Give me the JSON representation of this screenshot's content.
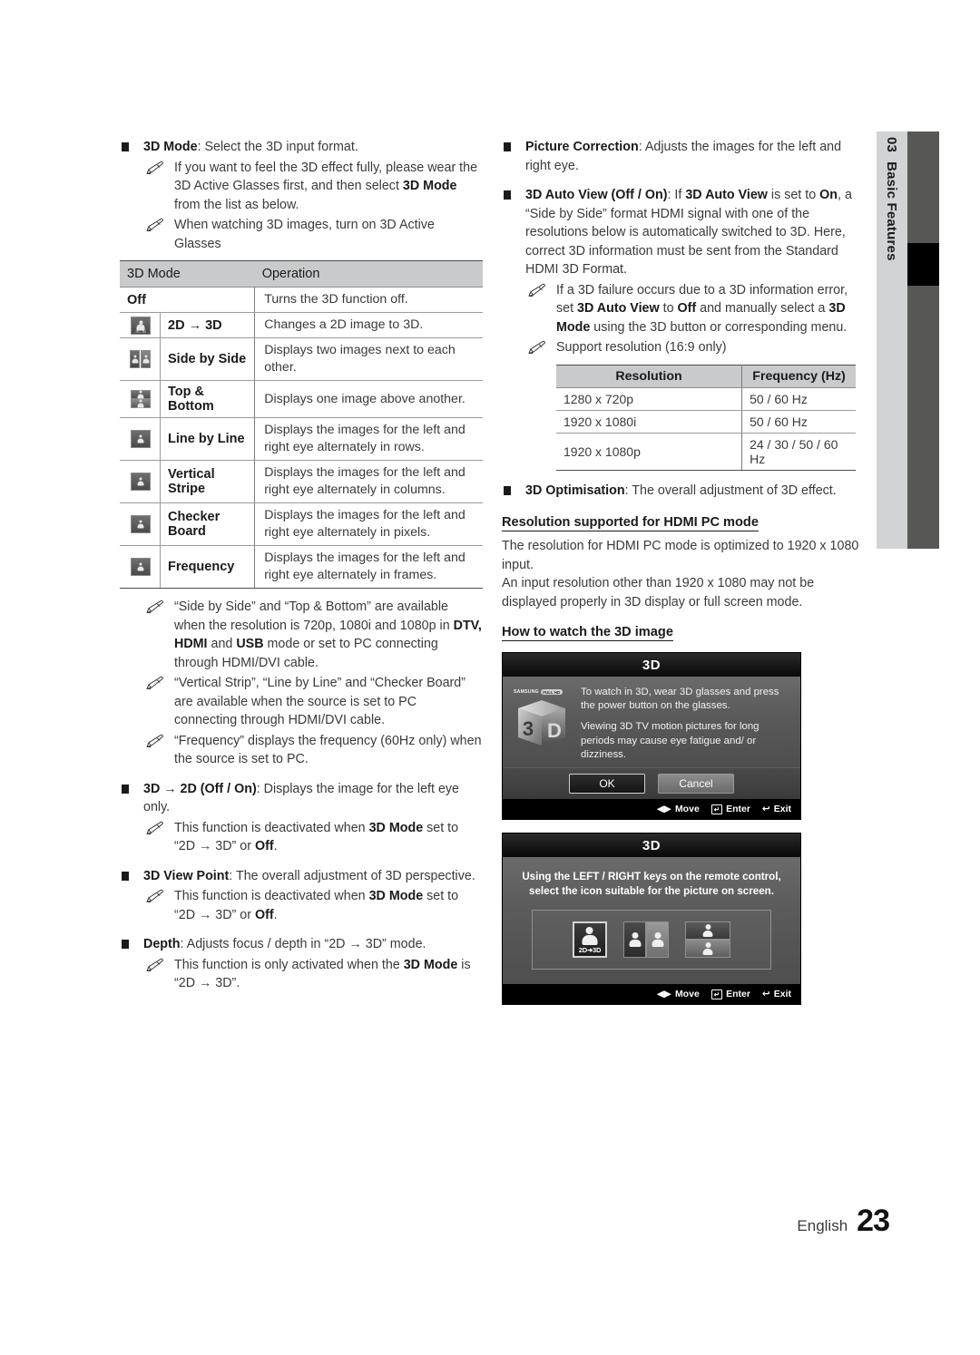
{
  "sidetab": {
    "chapter_number": "03",
    "chapter_title": "Basic Features"
  },
  "footer": {
    "language": "English",
    "page_number": "23"
  },
  "left_column": {
    "item_3d_mode": {
      "term": "3D Mode",
      "rest": ": Select the 3D input format.",
      "notes": [
        "If you want to feel the 3D effect fully, please wear the 3D Active Glasses first, and then select 3D Mode from the list as below.",
        "When watching 3D images, turn on 3D Active Glasses"
      ],
      "note1_a": "If you want to feel the 3D effect fully, please wear the 3D Active Glasses first, and then select ",
      "note1_b": "3D Mode",
      "note1_c": " from the list as below.",
      "note2": "When watching 3D images, turn on 3D Active Glasses"
    },
    "mode_table": {
      "headers": [
        "3D Mode",
        "Operation"
      ],
      "rows": [
        {
          "icon": "none",
          "name": "Off",
          "desc": "Turns the 3D function off."
        },
        {
          "icon": "2d-to-3d-icon",
          "name": "2D → 3D",
          "desc": "Changes a 2D image to 3D."
        },
        {
          "icon": "side-by-side-icon",
          "name": "Side by Side",
          "desc": "Displays two images next to each other."
        },
        {
          "icon": "top-bottom-icon",
          "name": "Top & Bottom",
          "desc": "Displays one image above another."
        },
        {
          "icon": "line-by-line-icon",
          "name": "Line by Line",
          "desc": "Displays the images for the left and right eye alternately in rows."
        },
        {
          "icon": "vertical-stripe-icon",
          "name": "Vertical Stripe",
          "desc": "Displays the images for the left and right eye alternately in columns."
        },
        {
          "icon": "checker-board-icon",
          "name": "Checker Board",
          "desc": "Displays the images for the left and right eye alternately in pixels."
        },
        {
          "icon": "frequency-icon",
          "name": "Frequency",
          "desc": "Displays the images for the left and right eye alternately in frames."
        }
      ]
    },
    "notes_after_table": [
      {
        "parts": [
          {
            "t": "“Side by Side” and “Top & Bottom” are available when the resolution is 720p, 1080i and 1080p in ",
            "b": false
          },
          {
            "t": "DTV, HDMI",
            "b": true
          },
          {
            "t": " and ",
            "b": false
          },
          {
            "t": "USB",
            "b": true
          },
          {
            "t": " mode or set to PC connecting through HDMI/DVI cable.",
            "b": false
          }
        ]
      },
      {
        "parts": [
          {
            "t": "“Vertical Strip”, “Line by Line” and “Checker Board” are available when the source is set to PC connecting through HDMI/DVI cable.",
            "b": false
          }
        ]
      },
      {
        "parts": [
          {
            "t": "“Frequency” displays the frequency (60Hz only) when the source is set to PC.",
            "b": false
          }
        ]
      }
    ],
    "item_3d_to_2d": {
      "term": "3D → 2D (Off / On)",
      "rest": ": Displays the image for the left eye only.",
      "note_parts": [
        {
          "t": "This function is deactivated when ",
          "b": false
        },
        {
          "t": "3D Mode",
          "b": true
        },
        {
          "t": " set to “2D → 3D” or ",
          "b": false
        },
        {
          "t": "Off",
          "b": true
        },
        {
          "t": ".",
          "b": false
        }
      ]
    },
    "item_view_point": {
      "term": "3D View Point",
      "rest": ": The overall adjustment of 3D perspective.",
      "note_parts": [
        {
          "t": "This function is deactivated when ",
          "b": false
        },
        {
          "t": "3D Mode",
          "b": true
        },
        {
          "t": " set to “2D → 3D” or ",
          "b": false
        },
        {
          "t": "Off",
          "b": true
        },
        {
          "t": ".",
          "b": false
        }
      ]
    },
    "item_depth": {
      "term": "Depth",
      "rest": ": Adjusts focus / depth in “2D → 3D” mode.",
      "note_parts": [
        {
          "t": "This function is only activated when the ",
          "b": false
        },
        {
          "t": "3D Mode",
          "b": true
        },
        {
          "t": " is “2D → 3D”.",
          "b": false
        }
      ]
    }
  },
  "right_column": {
    "item_picture_correction": {
      "term": "Picture Correction",
      "rest": ": Adjusts the images for the left and right eye."
    },
    "item_auto_view": {
      "parts": [
        {
          "t": "3D Auto View (Off / On)",
          "b": true
        },
        {
          "t": ": If ",
          "b": false
        },
        {
          "t": "3D Auto View",
          "b": true
        },
        {
          "t": " is set to ",
          "b": false
        },
        {
          "t": "On",
          "b": true
        },
        {
          "t": ", a “Side by Side” format HDMI signal with one of the resolutions below is automatically switched to 3D. Here, correct 3D information must be sent from the Standard HDMI 3D Format.",
          "b": false
        }
      ],
      "note1_parts": [
        {
          "t": "If a 3D failure occurs due to a 3D information error, set ",
          "b": false
        },
        {
          "t": "3D Auto View",
          "b": true
        },
        {
          "t": " to ",
          "b": false
        },
        {
          "t": "Off",
          "b": true
        },
        {
          "t": " and manually select a ",
          "b": false
        },
        {
          "t": "3D Mode",
          "b": true
        },
        {
          "t": " using the 3D button or corresponding menu.",
          "b": false
        }
      ],
      "note2": "Support resolution (16:9 only)"
    },
    "resolution_table": {
      "headers": [
        "Resolution",
        "Frequency (Hz)"
      ],
      "rows": [
        [
          "1280 x 720p",
          "50 / 60 Hz"
        ],
        [
          "1920 x 1080i",
          "50 / 60 Hz"
        ],
        [
          "1920 x 1080p",
          "24 / 30 / 50 / 60 Hz"
        ]
      ]
    },
    "item_optimisation": {
      "term": "3D Optimisation",
      "rest": ": The overall adjustment of 3D effect."
    },
    "heading_hdmi_pc": "Resolution supported for HDMI PC mode",
    "para_hdmi_pc_1": "The resolution for HDMI PC mode is optimized to 1920 x 1080 input.",
    "para_hdmi_pc_2": "An input resolution other than 1920 x 1080 may not be displayed properly in 3D display or full screen mode.",
    "heading_how_to_watch": "How to watch the 3D image"
  },
  "tv_screen_1": {
    "title": "3D",
    "logo_brand": "SAMSUNG",
    "logo_badge": "FULL HD",
    "logo_text": "3D",
    "body_line_1": "To watch in 3D, wear 3D glasses and press the power button on the glasses.",
    "body_line_2": "Viewing 3D TV motion pictures for long periods may cause eye  fatigue and/ or dizziness.",
    "buttons": {
      "ok": "OK",
      "cancel": "Cancel"
    },
    "footer_hints": [
      {
        "icon": "left-right-arrow-icon",
        "label": "Move"
      },
      {
        "icon": "enter-key-icon",
        "label": "Enter"
      },
      {
        "icon": "return-arrow-icon",
        "label": "Exit"
      }
    ]
  },
  "tv_screen_2": {
    "title": "3D",
    "body_line_1": "Using the LEFT / RIGHT keys on the remote control,",
    "body_line_2": "select the icon suitable for the picture on screen.",
    "icons": [
      {
        "name": "2d-to-3d-mode-icon",
        "caption": "2D➜3D",
        "selected": true
      },
      {
        "name": "side-by-side-mode-icon",
        "caption": "",
        "selected": false
      },
      {
        "name": "top-bottom-mode-icon",
        "caption": "",
        "selected": false
      }
    ],
    "footer_hints": [
      {
        "icon": "left-right-arrow-icon",
        "label": "Move"
      },
      {
        "icon": "enter-key-icon",
        "label": "Enter"
      },
      {
        "icon": "return-arrow-icon",
        "label": "Exit"
      }
    ]
  }
}
